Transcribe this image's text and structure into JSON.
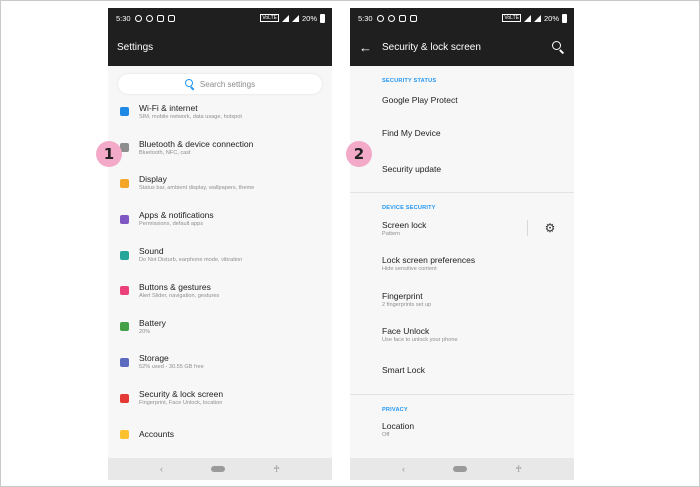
{
  "screen1": {
    "status": {
      "time": "5:30",
      "network": "VoLTE",
      "battery": "20%"
    },
    "title": "Settings",
    "search_placeholder": "Search settings",
    "items": [
      {
        "title": "Wi-Fi & internet",
        "subtitle": "SIM, mobile network, data usage, hotspot",
        "icon": "wifi-icon",
        "color": "#1e88e5"
      },
      {
        "title": "Bluetooth & device connection",
        "subtitle": "Bluetooth, NFC, cast",
        "icon": "bluetooth-icon",
        "color": "#8e8e8e"
      },
      {
        "title": "Display",
        "subtitle": "Status bar, ambient display, wallpapers, theme",
        "icon": "brightness-icon",
        "color": "#f4a62a"
      },
      {
        "title": "Apps & notifications",
        "subtitle": "Permissions, default apps",
        "icon": "apps-icon",
        "color": "#7e57c2"
      },
      {
        "title": "Sound",
        "subtitle": "Do Not Disturb, earphone mode, vibration",
        "icon": "speaker-icon",
        "color": "#26a69a"
      },
      {
        "title": "Buttons & gestures",
        "subtitle": "Alert Slider, navigation, gestures",
        "icon": "gesture-icon",
        "color": "#ec407a"
      },
      {
        "title": "Battery",
        "subtitle": "20%",
        "icon": "battery-icon",
        "color": "#43a047"
      },
      {
        "title": "Storage",
        "subtitle": "52% used - 30.55 GB free",
        "icon": "storage-icon",
        "color": "#5c6bc0"
      },
      {
        "title": "Security & lock screen",
        "subtitle": "Fingerprint, Face Unlock, location",
        "icon": "lock-icon",
        "color": "#e53935"
      },
      {
        "title": "Accounts",
        "subtitle": "",
        "icon": "account-icon",
        "color": "#fbc02d"
      }
    ],
    "badge": "1"
  },
  "screen2": {
    "status": {
      "time": "5:30",
      "network": "VoLTE",
      "battery": "20%"
    },
    "title": "Security & lock screen",
    "sections": [
      {
        "header": "SECURITY STATUS",
        "items": [
          {
            "title": "Google Play Protect",
            "subtitle": ""
          },
          {
            "title": "Find My Device",
            "subtitle": ""
          },
          {
            "title": "Security update",
            "subtitle": ""
          }
        ]
      },
      {
        "header": "DEVICE SECURITY",
        "items": [
          {
            "title": "Screen lock",
            "subtitle": "Pattern",
            "gear": true
          },
          {
            "title": "Lock screen preferences",
            "subtitle": "Hide sensitive content"
          },
          {
            "title": "Fingerprint",
            "subtitle": "2 fingerprints set up"
          },
          {
            "title": "Face Unlock",
            "subtitle": "Use face to unlock your phone"
          },
          {
            "title": "Smart Lock",
            "subtitle": ""
          }
        ]
      },
      {
        "header": "PRIVACY",
        "items": [
          {
            "title": "Location",
            "subtitle": "Off"
          }
        ]
      }
    ],
    "badge": "2"
  },
  "navbar": {
    "back": "‹",
    "accessibility": "♰"
  },
  "colors": {
    "appbar": "#1f1f1f",
    "accent": "#2196f3",
    "badge": "#f3a9c8"
  }
}
